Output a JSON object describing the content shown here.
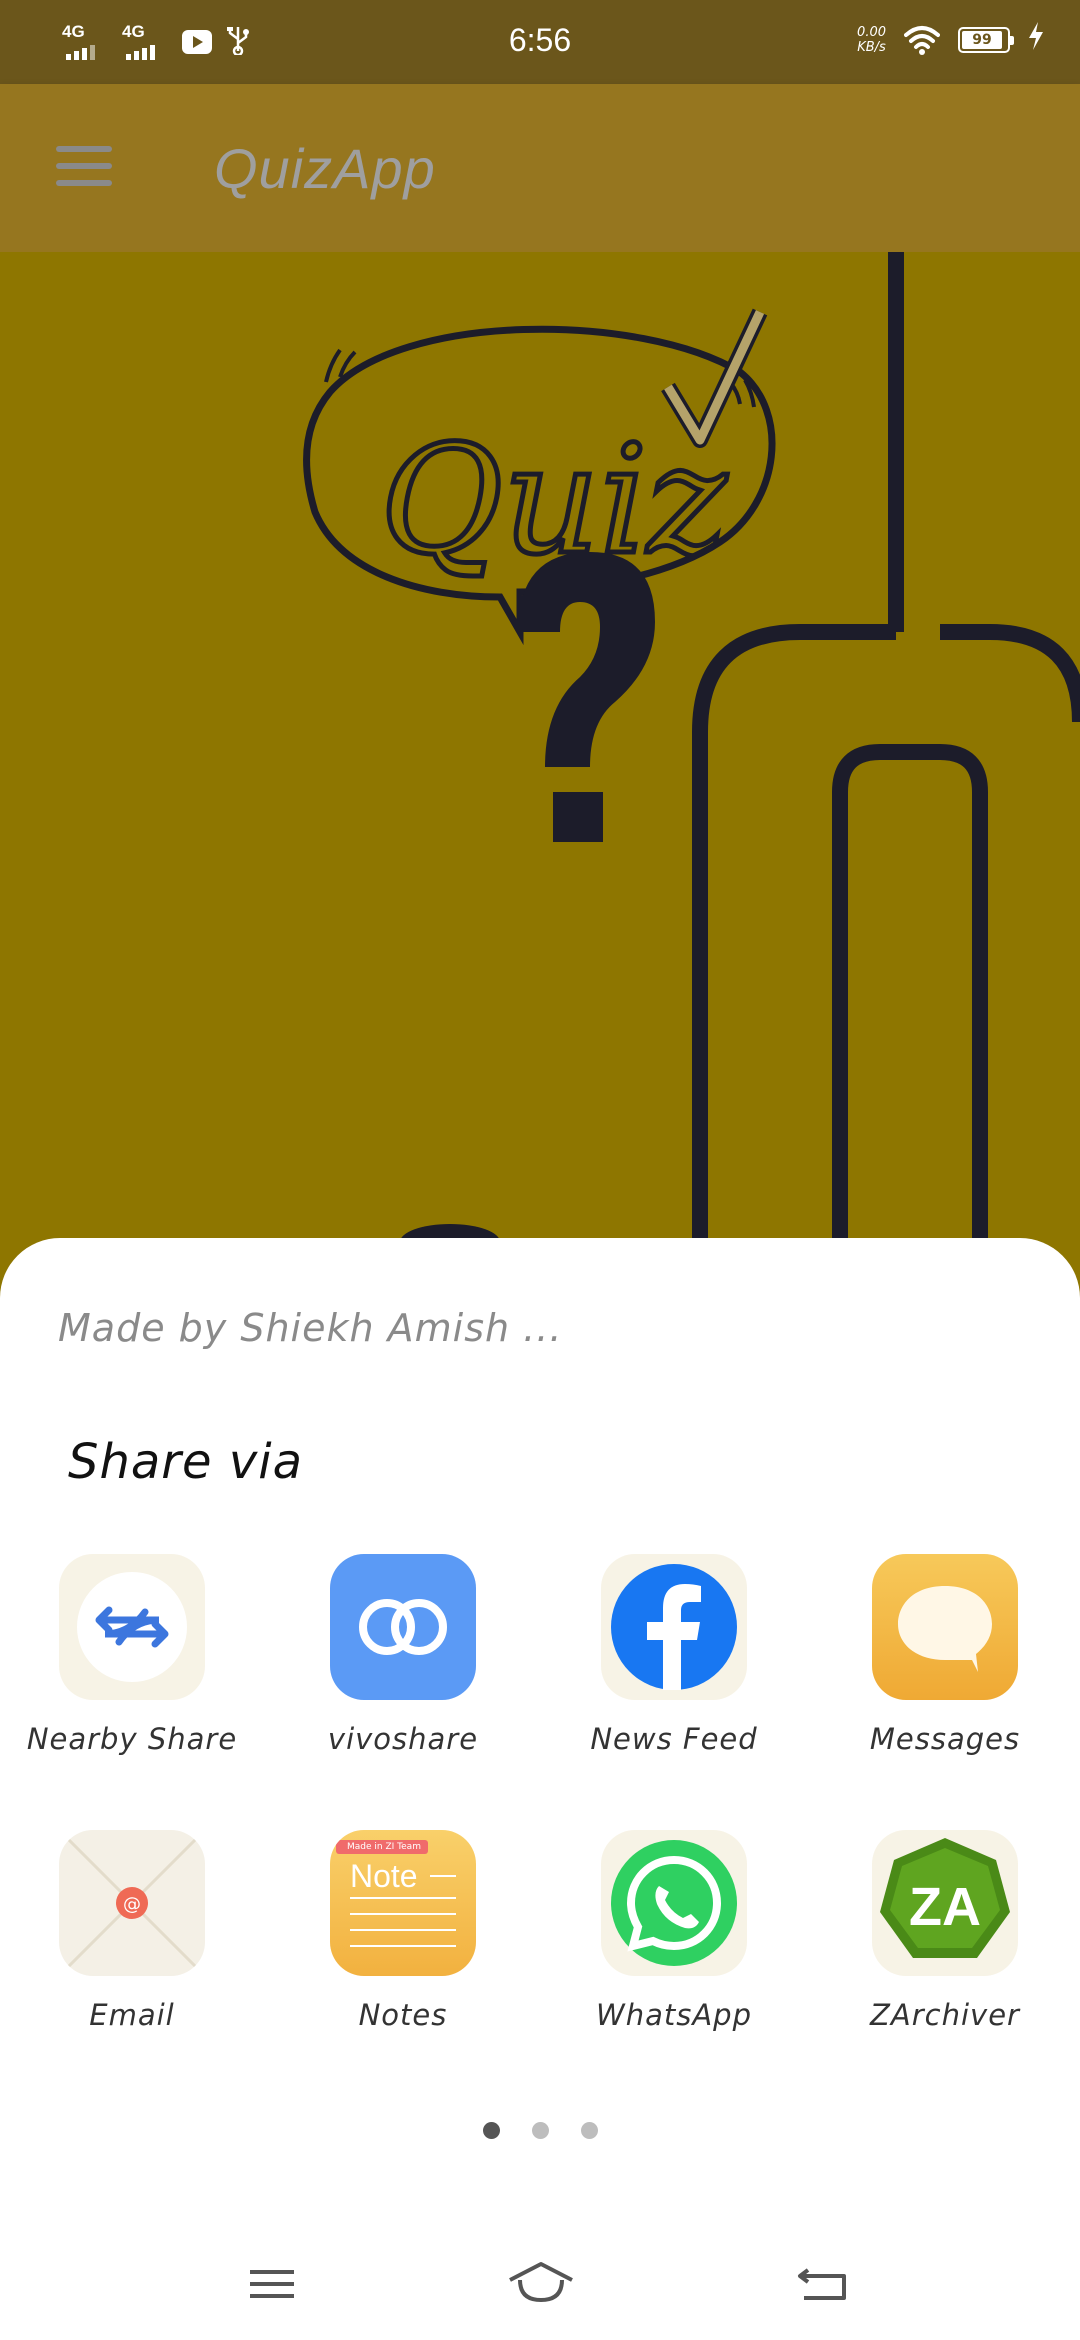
{
  "status_bar": {
    "network_1": "4G",
    "network_2": "4G",
    "time": "6:56",
    "speed_value": "0.00",
    "speed_unit": "KB/s",
    "battery": "99",
    "icons": [
      "signal-icon",
      "signal-icon",
      "youtube-icon",
      "usb-icon",
      "wifi-icon",
      "battery-icon",
      "charging-icon"
    ]
  },
  "app_bar": {
    "title": "QuizApp",
    "menu_icon": "hamburger-menu-icon"
  },
  "hero": {
    "image": "quiz-illustration",
    "text": "Quiz",
    "colors": {
      "background": "#8e7600",
      "ink": "#1c1c2a",
      "check": "#b5a36a"
    }
  },
  "share_sheet": {
    "message": "Made by Shiekh Amish ...",
    "title": "Share via",
    "apps": [
      {
        "label": "Nearby Share",
        "icon": "nearby-share-icon"
      },
      {
        "label": "vivoshare",
        "icon": "vivoshare-icon"
      },
      {
        "label": "News Feed",
        "icon": "facebook-icon"
      },
      {
        "label": "Messages",
        "icon": "messages-icon"
      },
      {
        "label": "Email",
        "icon": "email-icon"
      },
      {
        "label": "Notes",
        "icon": "notes-icon"
      },
      {
        "label": "WhatsApp",
        "icon": "whatsapp-icon"
      },
      {
        "label": "ZArchiver",
        "icon": "zarchiver-icon"
      }
    ],
    "notes_badge": "Made in ZI Team",
    "notes_icon_text": "Note",
    "zarchiver_icon_text": "ZA",
    "pages": 3,
    "current_page": 1
  },
  "nav_bar": {
    "buttons": [
      "recents-menu-icon",
      "home-icon",
      "back-icon"
    ]
  }
}
